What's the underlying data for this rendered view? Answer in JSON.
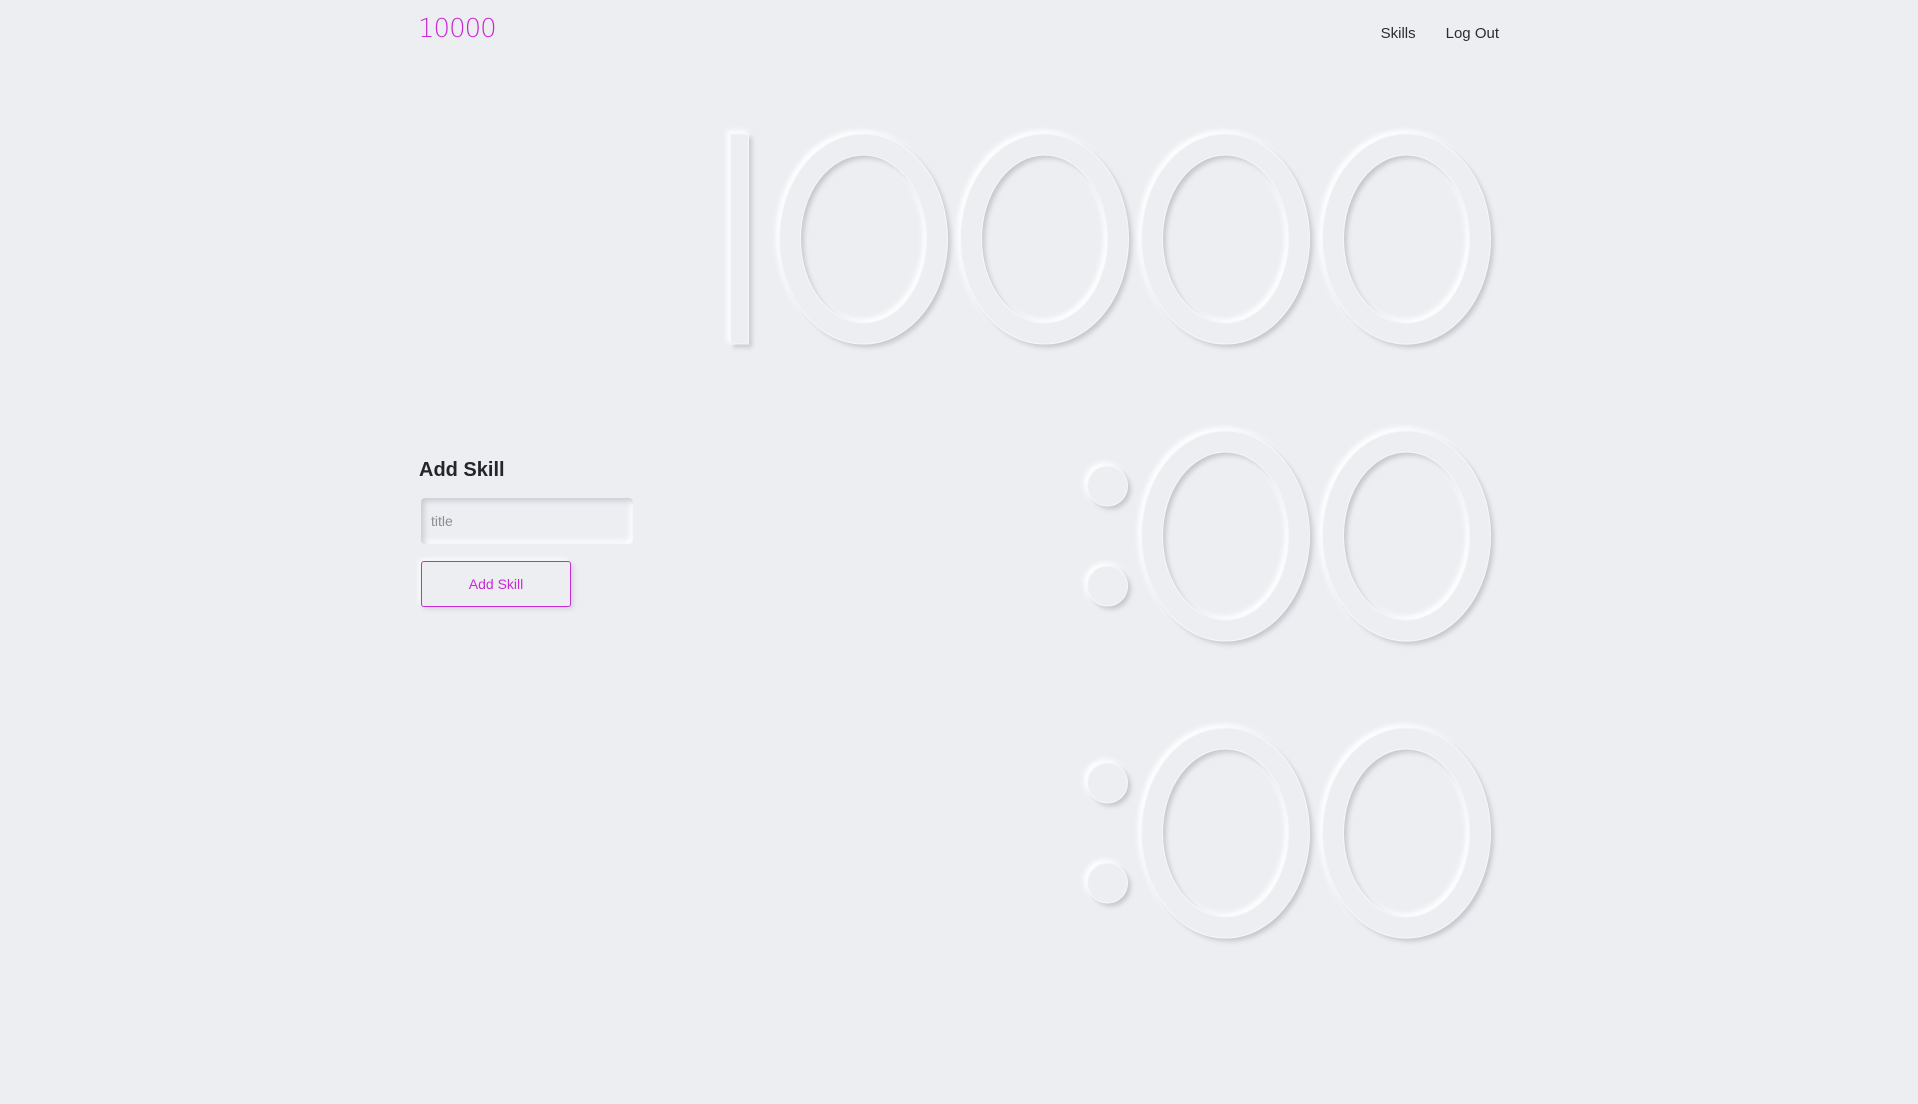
{
  "header": {
    "logo_text": "10000",
    "nav": [
      {
        "label": "Skills"
      },
      {
        "label": "Log Out"
      }
    ]
  },
  "timer": {
    "hours": "10000",
    "minutes": "00",
    "seconds": "00",
    "separator": ":"
  },
  "add_skill": {
    "heading": "Add Skill",
    "title_placeholder": "title",
    "title_value": "",
    "button_label": "Add Skill"
  },
  "colors": {
    "accent": "#c82bd6",
    "background": "#eceef2"
  }
}
